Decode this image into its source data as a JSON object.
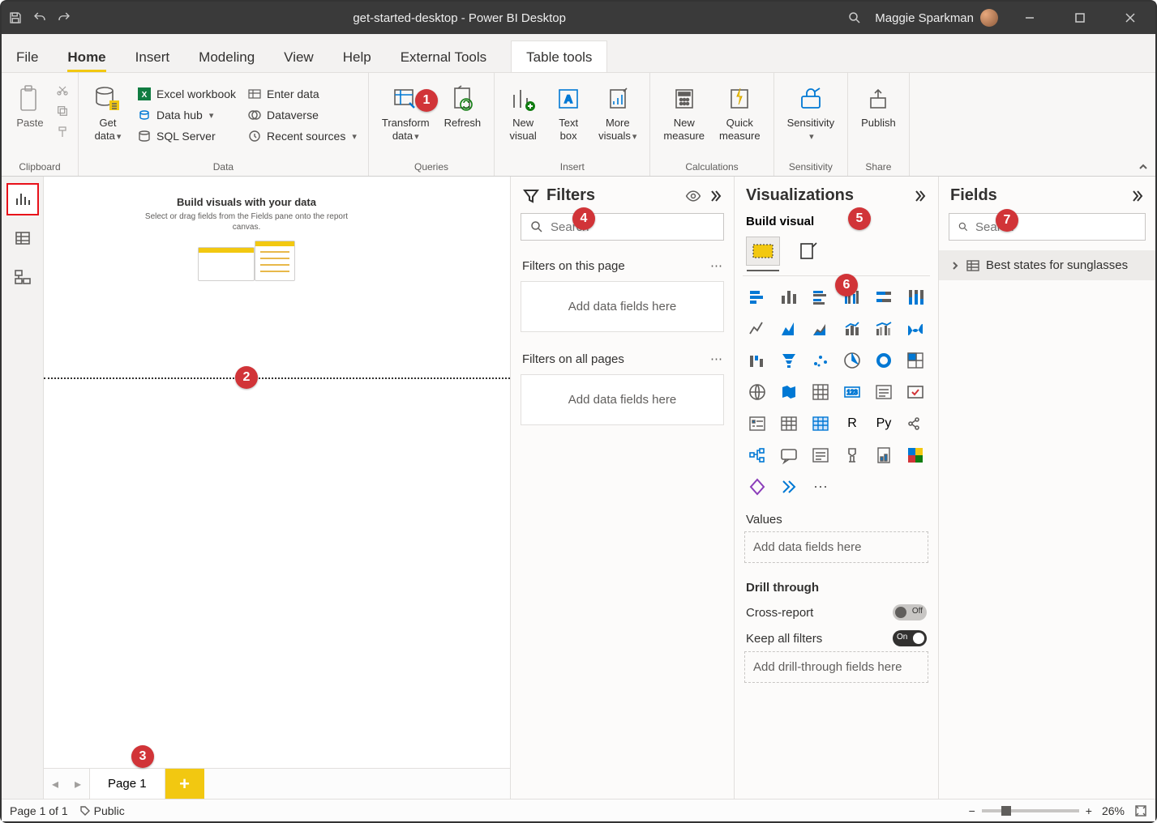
{
  "titlebar": {
    "title": "get-started-desktop - Power BI Desktop",
    "user": "Maggie Sparkman"
  },
  "menu": {
    "tabs": [
      "File",
      "Home",
      "Insert",
      "Modeling",
      "View",
      "Help",
      "External Tools"
    ],
    "context_tab": "Table tools",
    "active": "Home"
  },
  "ribbon": {
    "clipboard": {
      "paste": "Paste",
      "label": "Clipboard"
    },
    "data": {
      "get_data": "Get\ndata",
      "excel": "Excel workbook",
      "data_hub": "Data hub",
      "sql": "SQL Server",
      "enter_data": "Enter data",
      "dataverse": "Dataverse",
      "recent": "Recent sources",
      "label": "Data"
    },
    "queries": {
      "transform": "Transform\ndata",
      "refresh": "Refresh",
      "label": "Queries"
    },
    "insert": {
      "new_visual": "New\nvisual",
      "text_box": "Text\nbox",
      "more_visuals": "More\nvisuals",
      "label": "Insert"
    },
    "calc": {
      "new_measure": "New\nmeasure",
      "quick_measure": "Quick\nmeasure",
      "label": "Calculations"
    },
    "sensitivity": {
      "btn": "Sensitivity",
      "label": "Sensitivity"
    },
    "share": {
      "publish": "Publish",
      "label": "Share"
    }
  },
  "canvas": {
    "placeholder_title": "Build visuals with your data",
    "placeholder_sub": "Select or drag fields from the Fields pane onto the report canvas.",
    "page_tab": "Page 1"
  },
  "filters": {
    "title": "Filters",
    "search_placeholder": "Search",
    "this_page": "Filters on this page",
    "all_pages": "Filters on all pages",
    "dropzone": "Add data fields here"
  },
  "viz": {
    "title": "Visualizations",
    "subtitle": "Build visual",
    "values_label": "Values",
    "values_drop": "Add data fields here",
    "drill_label": "Drill through",
    "cross_report": "Cross-report",
    "keep_filters": "Keep all filters",
    "drill_drop": "Add drill-through fields here"
  },
  "fields": {
    "title": "Fields",
    "search_placeholder": "Search",
    "table": "Best states for sunglasses"
  },
  "status": {
    "page": "Page 1 of 1",
    "sensitivity": "Public",
    "zoom": "26%"
  },
  "badges": {
    "1": "1",
    "2": "2",
    "3": "3",
    "4": "4",
    "5": "5",
    "6": "6",
    "7": "7"
  }
}
